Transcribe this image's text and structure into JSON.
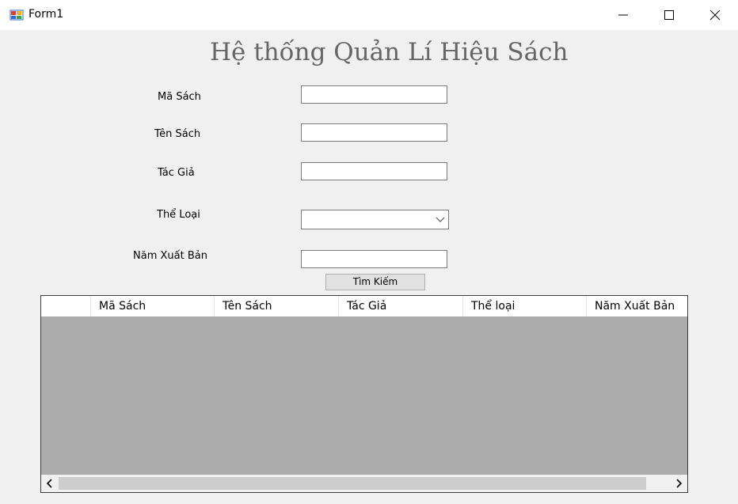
{
  "window": {
    "title": "Form1"
  },
  "heading": "Hệ thống Quản Lí Hiệu Sách",
  "form": {
    "ma_sach_label": "Mã Sách",
    "ten_sach_label": "Tên Sách",
    "tac_gia_label": "Tác Giả",
    "the_loai_label": "Thể Loại",
    "nam_xuat_ban_label": "Năm Xuất Bản",
    "ma_sach_value": "",
    "ten_sach_value": "",
    "tac_gia_value": "",
    "the_loai_value": "",
    "nam_xuat_ban_value": "",
    "search_button": "Tìm Kiếm"
  },
  "grid": {
    "columns": [
      "Mã Sách",
      "Tên Sách",
      "Tác Giả",
      "Thể loại",
      "Năm Xuất Bản"
    ],
    "rows": []
  },
  "colors": {
    "heading": "#666666",
    "grid_background": "#ababab"
  }
}
